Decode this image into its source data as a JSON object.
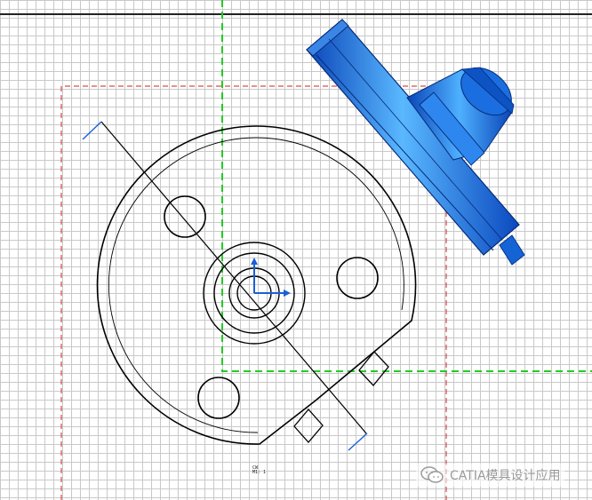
{
  "app": "CATIA",
  "workbench_view": {
    "label_line1": "CW",
    "label_line2": "M1: 1"
  },
  "colors": {
    "sketch_frame": "#d02020",
    "drawing_frame": "#22cc22",
    "part_3d": "#1564d6",
    "axis": "#1a5fd8",
    "geometry": "#000000"
  },
  "watermark": {
    "text": "CATIA模具设计应用",
    "icon": "wechat-icon"
  }
}
